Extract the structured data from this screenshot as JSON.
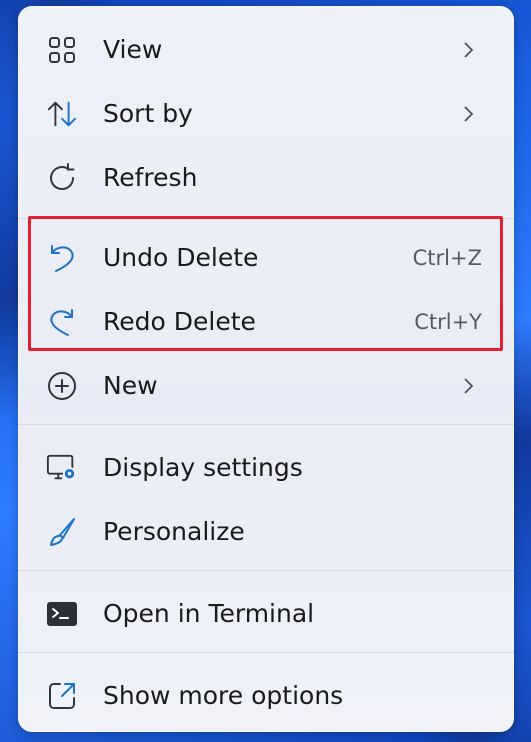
{
  "menu": {
    "items": [
      {
        "id": "view",
        "label": "View",
        "icon": "grid-icon",
        "submenu": true
      },
      {
        "id": "sort",
        "label": "Sort by",
        "icon": "sort-arrows-icon",
        "submenu": true
      },
      {
        "id": "refresh",
        "label": "Refresh",
        "icon": "refresh-icon"
      },
      {
        "id": "undo",
        "label": "Undo Delete",
        "icon": "undo-icon",
        "shortcut": "Ctrl+Z"
      },
      {
        "id": "redo",
        "label": "Redo Delete",
        "icon": "redo-icon",
        "shortcut": "Ctrl+Y"
      },
      {
        "id": "new",
        "label": "New",
        "icon": "plus-circle-icon",
        "submenu": true
      },
      {
        "id": "display",
        "label": "Display settings",
        "icon": "display-settings-icon"
      },
      {
        "id": "personalize",
        "label": "Personalize",
        "icon": "brush-icon"
      },
      {
        "id": "terminal",
        "label": "Open in Terminal",
        "icon": "terminal-icon"
      },
      {
        "id": "more",
        "label": "Show more options",
        "icon": "share-out-icon"
      }
    ]
  },
  "colors": {
    "accent": "#1e72c8",
    "highlight_border": "#e3202f",
    "wallpaper": "#1e66e8"
  }
}
